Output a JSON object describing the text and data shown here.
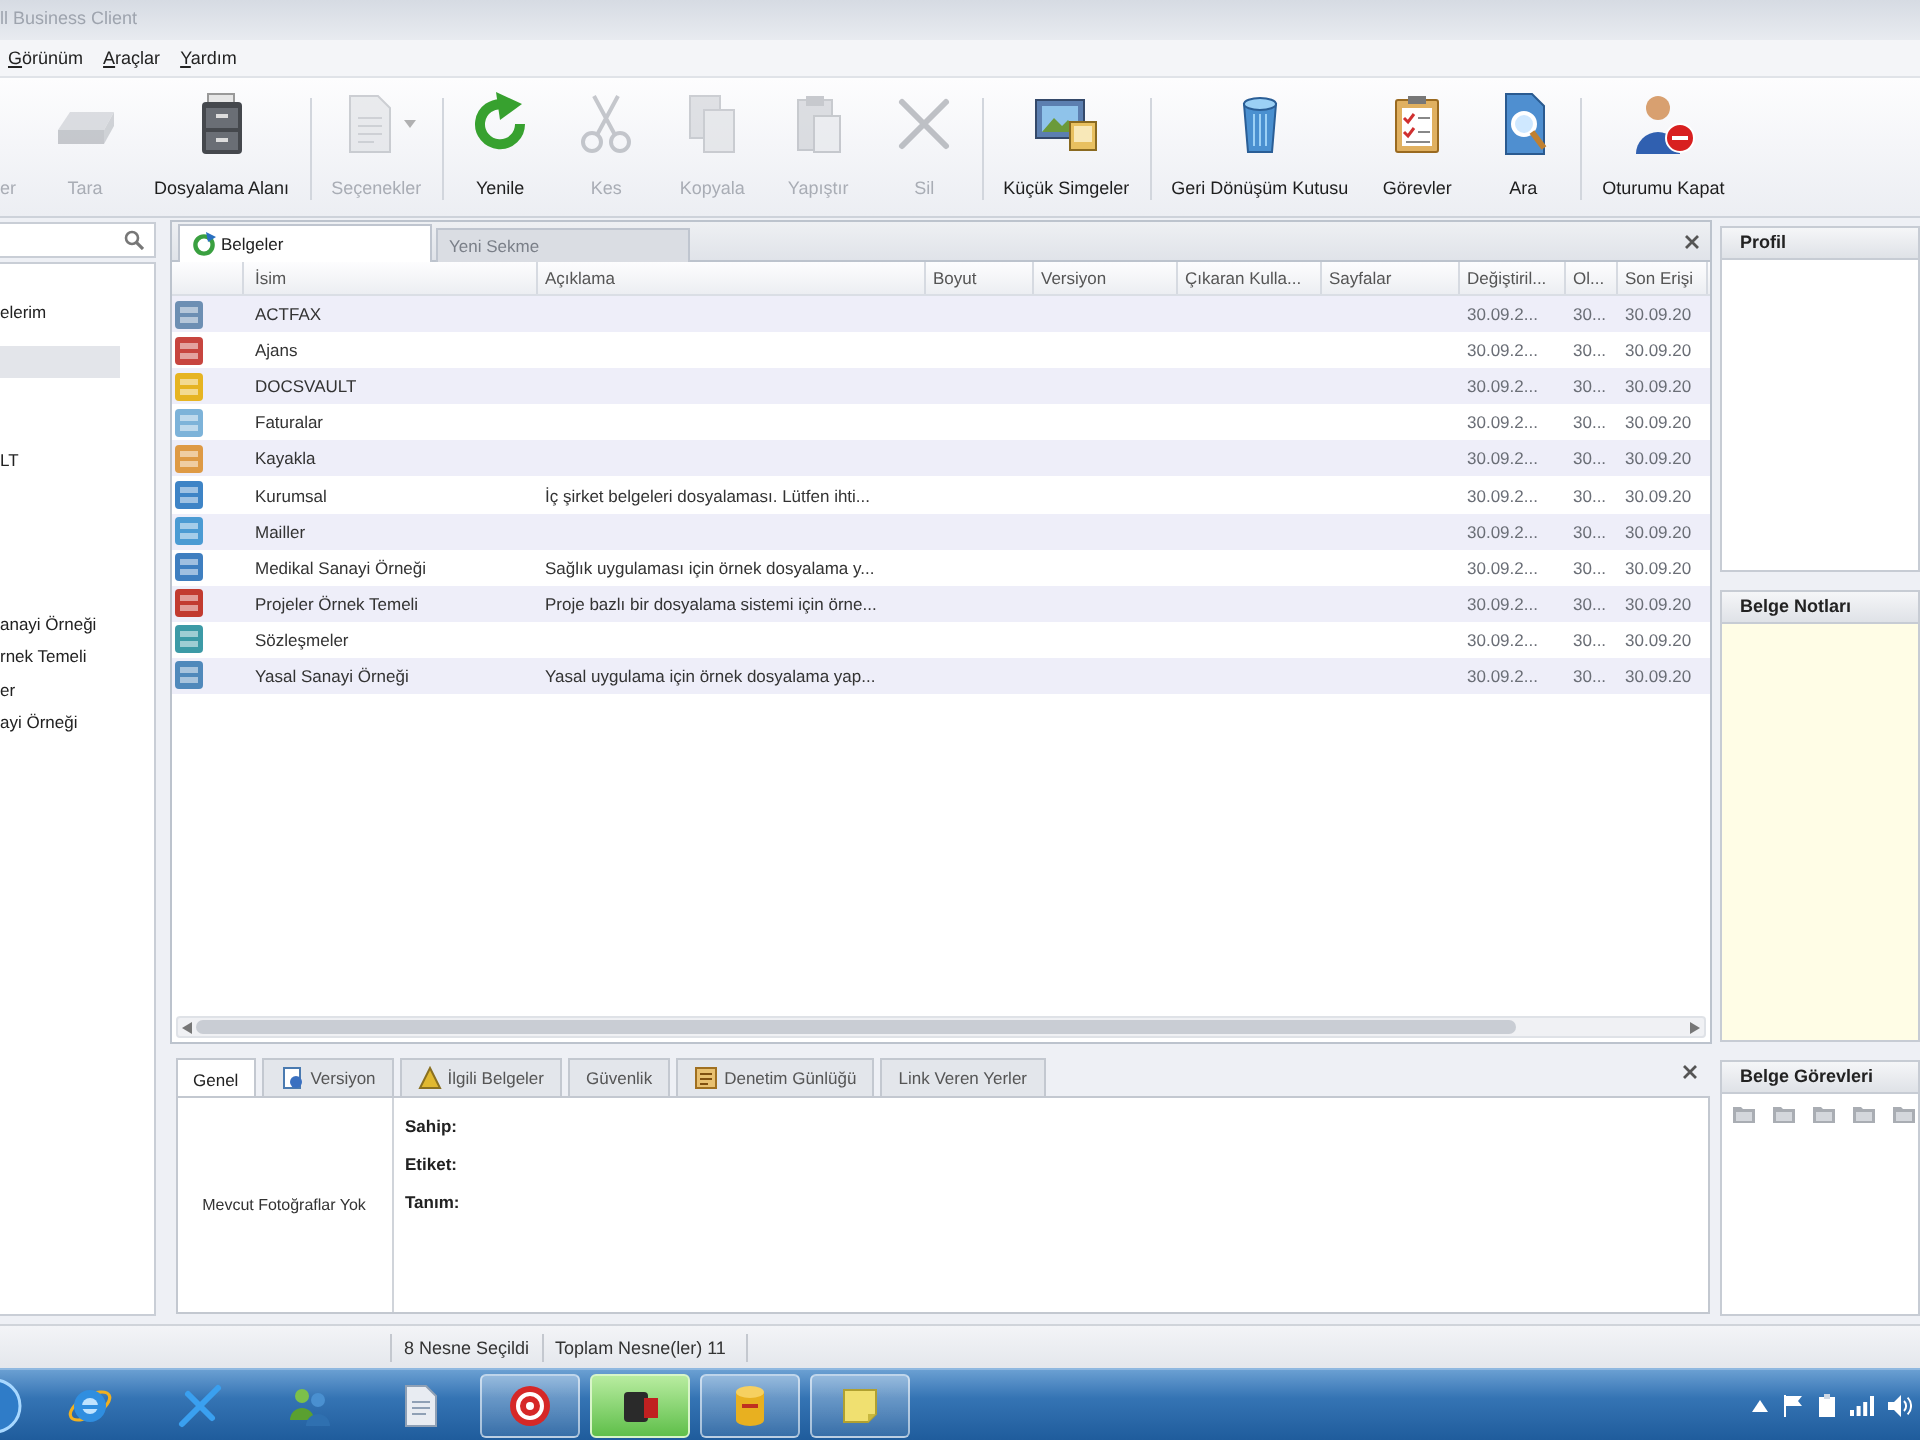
{
  "window": {
    "title": "ll Business Client"
  },
  "menu": [
    "Görünüm",
    "Araçlar",
    "Yardım"
  ],
  "toolbar": {
    "groups": [
      [
        {
          "label": "er",
          "disabled": true,
          "dropdown": false
        },
        {
          "label": "Tara",
          "disabled": true,
          "dropdown": false
        },
        {
          "label": "Dosyalama Alanı",
          "disabled": false,
          "dropdown": false
        }
      ],
      [
        {
          "label": "Seçenekler",
          "disabled": true,
          "dropdown": true
        }
      ],
      [
        {
          "label": "Yenile",
          "disabled": false,
          "dropdown": false
        },
        {
          "label": "Kes",
          "disabled": true,
          "dropdown": false
        },
        {
          "label": "Kopyala",
          "disabled": true,
          "dropdown": false
        },
        {
          "label": "Yapıştır",
          "disabled": true,
          "dropdown": false
        },
        {
          "label": "Sil",
          "disabled": true,
          "dropdown": false
        }
      ],
      [
        {
          "label": "Küçük Simgeler",
          "disabled": false,
          "dropdown": false
        }
      ],
      [
        {
          "label": "Geri Dönüşüm Kutusu",
          "disabled": false,
          "dropdown": false
        },
        {
          "label": "Görevler",
          "disabled": false,
          "dropdown": false
        },
        {
          "label": "Ara",
          "disabled": false,
          "dropdown": false
        }
      ],
      [
        {
          "label": "Oturumu Kapat",
          "disabled": false,
          "dropdown": false
        }
      ]
    ]
  },
  "sidebar": {
    "items": [
      {
        "label": "elerim",
        "selected": false
      },
      {
        "selected": true
      },
      {
        "label": "LT",
        "selected": false
      },
      {
        "label": "anayi Örneği",
        "selected": false
      },
      {
        "label": "rnek Temeli",
        "selected": false
      },
      {
        "label": "er",
        "selected": false
      },
      {
        "label": "ayi Örneği",
        "selected": false
      }
    ]
  },
  "documents": {
    "tabs": [
      {
        "label": "Belgeler",
        "selected": true
      },
      {
        "label": "Yeni Sekme",
        "selected": false
      }
    ],
    "columns": [
      "İsim",
      "Açıklama",
      "Boyut",
      "Versiyon",
      "Çıkaran Kulla...",
      "Sayfalar",
      "Değiştiril...",
      "Ol...",
      "Son Erişi"
    ],
    "rows": [
      {
        "color": "#6d8fb3",
        "name": "ACTFAX",
        "column_7": "30.09.2...",
        "column_8": "30...",
        "column_9": "30.09.20"
      },
      {
        "color": "#c7453f",
        "name": "Ajans",
        "column_7": "30.09.2...",
        "column_8": "30...",
        "column_9": "30.09.20"
      },
      {
        "color": "#e6b422",
        "name": "DOCSVAULT",
        "column_7": "30.09.2...",
        "column_8": "30...",
        "column_9": "30.09.20"
      },
      {
        "color": "#7db3d9",
        "name": "Faturalar",
        "column_7": "30.09.2...",
        "column_8": "30...",
        "column_9": "30.09.20"
      },
      {
        "color": "#de9a45",
        "name": "Kayakla",
        "column_7": "30.09.2...",
        "column_8": "30...",
        "column_9": "30.09.20"
      },
      {
        "color": "#3e84c6",
        "name": "Kurumsal",
        "description": "İç şirket belgeleri dosyalaması. Lütfen ihti...",
        "column_7": "30.09.2...",
        "column_8": "30...",
        "column_9": "30.09.20"
      },
      {
        "color": "#4b9bd3",
        "name": "Mailler",
        "column_7": "30.09.2...",
        "column_8": "30...",
        "column_9": "30.09.20"
      },
      {
        "color": "#3f7fc0",
        "name": "Medikal Sanayi Örneği",
        "description": "Sağlık uygulaması için örnek dosyalama y...",
        "column_7": "30.09.2...",
        "column_8": "30...",
        "column_9": "30.09.20"
      },
      {
        "color": "#c23b30",
        "name": "Projeler Örnek Temeli",
        "description": "Proje bazlı bir dosyalama sistemi için örne...",
        "column_7": "30.09.2...",
        "column_8": "30...",
        "column_9": "30.09.20"
      },
      {
        "color": "#3c9aa6",
        "name": "Sözleşmeler",
        "column_7": "30.09.2...",
        "column_8": "30...",
        "column_9": "30.09.20"
      },
      {
        "color": "#5089bb",
        "name": "Yasal Sanayi Örneği",
        "description": "Yasal uygulama için örnek dosyalama yap...",
        "column_7": "30.09.2...",
        "column_8": "30...",
        "column_9": "30.09.20"
      }
    ]
  },
  "details": {
    "tabs": [
      {
        "label": "Genel",
        "selected": true
      },
      {
        "label": "Versiyon",
        "selected": false
      },
      {
        "label": "İlgili Belgeler",
        "selected": false
      },
      {
        "label": "Güvenlik",
        "selected": false
      },
      {
        "label": "Denetim Günlüğü",
        "selected": false
      },
      {
        "label": "Link Veren Yerler",
        "selected": false
      }
    ],
    "photo_text": "Mevcut Fotoğraflar Yok",
    "fields": [
      "Sahip:",
      "Etiket:",
      "Tanım:"
    ]
  },
  "side_panels": [
    {
      "kind": "profile",
      "title": "Profil"
    },
    {
      "kind": "notes",
      "title": "Belge Notları"
    },
    {
      "kind": "tasks",
      "title": "Belge Görevleri"
    }
  ],
  "status_bar": [
    "8 Nesne Seçildi",
    "Toplam Nesne(ler) 11"
  ],
  "taskbar": {
    "items": [
      {
        "open": false,
        "selected": false
      },
      {
        "open": false,
        "selected": false
      },
      {
        "open": false,
        "selected": false
      },
      {
        "open": false,
        "selected": false
      },
      {
        "open": true,
        "selected": false
      },
      {
        "open": true,
        "selected": true
      },
      {
        "open": true,
        "selected": false
      },
      {
        "open": true,
        "selected": false
      }
    ]
  }
}
